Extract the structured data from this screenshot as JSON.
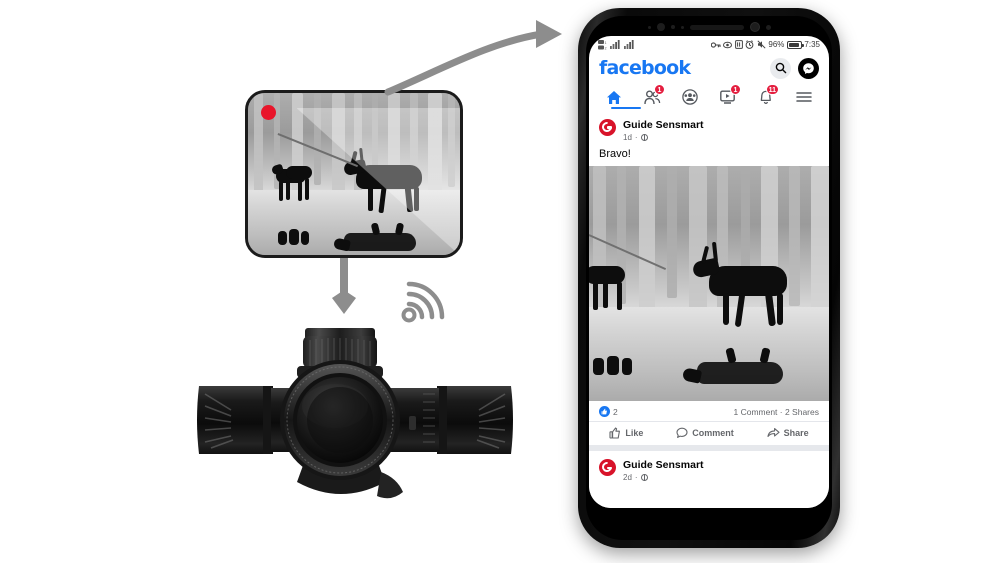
{
  "scene": {
    "title": "Thermal riflescope wireless streaming to Facebook app",
    "arrow_stream_name": "stream-arrow",
    "arrow_device_name": "device-arrow",
    "wifi_icon": "wifi-icon"
  },
  "thermal_display": {
    "recording_indicator": "recording-dot",
    "recording_color": "#e8152a",
    "scene_description": "Thermal image of deer and wolves in forest",
    "animals": [
      "deer",
      "wolf",
      "wolf",
      "boar",
      "boar"
    ]
  },
  "scope": {
    "name": "thermal-riflescope",
    "color": "#151515"
  },
  "phone": {
    "status_bar": {
      "left_icons": [
        "sim-signal-icon",
        "signal-bars-icon",
        "signal-bars-icon"
      ],
      "right_icons": [
        "key-icon",
        "eye-icon",
        "nfc-icon",
        "alarm-icon",
        "mute-icon"
      ],
      "battery_percent": "96%",
      "time": "7:35"
    },
    "app": {
      "logo_text": "facebook",
      "logo_color": "#1877F2",
      "header_icons": [
        {
          "name": "search-icon",
          "label": "Search"
        },
        {
          "name": "messenger-icon",
          "label": "Messenger"
        }
      ],
      "nav": [
        {
          "name": "tab-home",
          "icon": "home-icon",
          "active": true,
          "badge": ""
        },
        {
          "name": "tab-friends",
          "icon": "friends-icon",
          "active": false,
          "badge": "1"
        },
        {
          "name": "tab-groups",
          "icon": "groups-icon",
          "active": false,
          "badge": ""
        },
        {
          "name": "tab-watch",
          "icon": "watch-icon",
          "active": false,
          "badge": "1"
        },
        {
          "name": "tab-notifications",
          "icon": "bell-icon",
          "active": false,
          "badge": "11"
        },
        {
          "name": "tab-menu",
          "icon": "hamburger-icon",
          "active": false,
          "badge": ""
        }
      ],
      "badge_color": "#e41e3f",
      "posts": [
        {
          "author": "Guide Sensmart",
          "timestamp": "1d",
          "privacy_icon": "globe-icon",
          "text": "Bravo!",
          "media": "thermal-video-thumbnail",
          "reaction_count": "2",
          "comments_shares": "1 Comment · 2 Shares",
          "actions": [
            {
              "name": "like-button",
              "label": "Like",
              "icon": "thumbs-up-icon"
            },
            {
              "name": "comment-button",
              "label": "Comment",
              "icon": "comment-bubble-icon"
            },
            {
              "name": "share-button",
              "label": "Share",
              "icon": "share-arrow-icon"
            }
          ]
        },
        {
          "author": "Guide Sensmart",
          "timestamp": "2d",
          "privacy_icon": "globe-icon"
        }
      ]
    }
  }
}
